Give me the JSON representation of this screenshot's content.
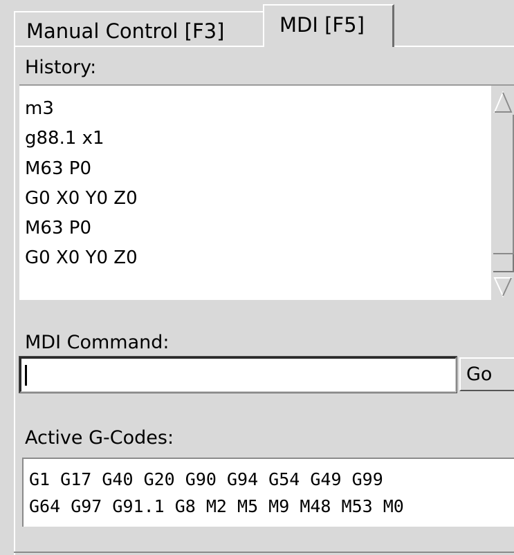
{
  "tabs": [
    {
      "label": "Manual Control [F3]",
      "active": false
    },
    {
      "label": "MDI [F5]",
      "active": true
    }
  ],
  "history": {
    "label": "History:",
    "items": [
      "m3",
      "g88.1 x1",
      "M63 P0",
      "G0 X0 Y0 Z0",
      "M63 P0",
      "G0 X0 Y0 Z0"
    ]
  },
  "mdi": {
    "label": "MDI Command:",
    "value": "",
    "go_label": "Go"
  },
  "active_gcodes": {
    "label": "Active G-Codes:",
    "lines": [
      "G1 G17 G40 G20 G90 G94 G54 G49 G99",
      "G64 G97 G91.1 G8 M2 M5 M9 M48 M53 M0"
    ]
  },
  "icons": {
    "scroll_up": "triangle-up-icon",
    "scroll_down": "triangle-down-icon"
  }
}
